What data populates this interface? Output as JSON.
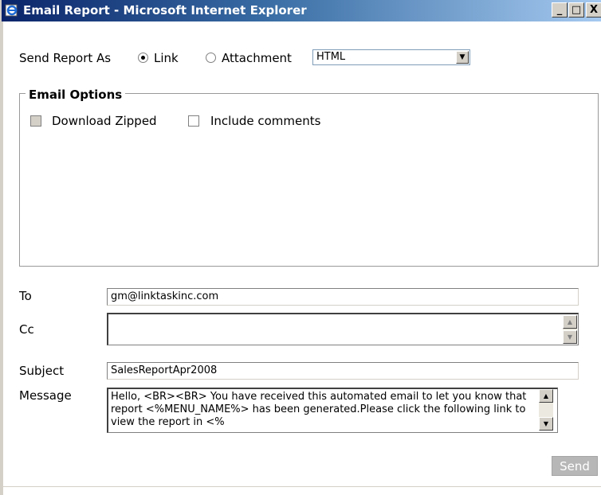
{
  "window": {
    "title": "Email Report - Microsoft Internet Explorer",
    "controls": {
      "minimize": "_",
      "maximize": "□",
      "close": "X"
    }
  },
  "send_as": {
    "label": "Send Report As",
    "options": [
      {
        "label": "Link",
        "selected": true
      },
      {
        "label": "Attachment",
        "selected": false
      }
    ],
    "format_select": {
      "value": "HTML"
    }
  },
  "email_options": {
    "legend": "Email Options",
    "checkboxes": [
      {
        "label": "Download Zipped",
        "checked": false,
        "disabled": true
      },
      {
        "label": "Include comments",
        "checked": false,
        "disabled": false
      }
    ]
  },
  "form": {
    "to": {
      "label": "To",
      "value": "gm@linktaskinc.com"
    },
    "cc": {
      "label": "Cc",
      "value": ""
    },
    "subject": {
      "label": "Subject",
      "value": "SalesReportApr2008"
    },
    "message": {
      "label": "Message",
      "value": "Hello, <BR><BR> You have received this automated email to let you know that report <%MENU_NAME%> has been generated.Please click the following link to view the report in <%"
    }
  },
  "actions": {
    "send_label": "Send"
  },
  "icons": {
    "window_icon": "ie-icon"
  }
}
